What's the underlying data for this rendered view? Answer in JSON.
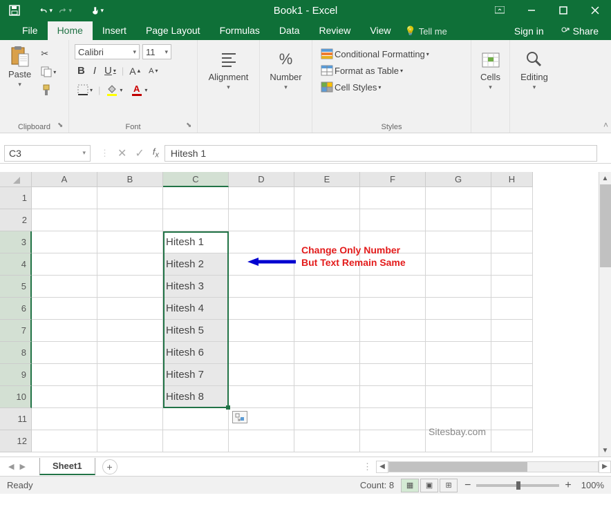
{
  "title": "Book1 - Excel",
  "tabs": {
    "file": "File",
    "home": "Home",
    "insert": "Insert",
    "pagelayout": "Page Layout",
    "formulas": "Formulas",
    "data": "Data",
    "review": "Review",
    "view": "View"
  },
  "tellme": "Tell me",
  "signin": "Sign in",
  "share": "Share",
  "ribbon": {
    "clipboard": {
      "paste": "Paste",
      "label": "Clipboard"
    },
    "font": {
      "name": "Calibri",
      "size": "11",
      "label": "Font"
    },
    "alignment": "Alignment",
    "number": "Number",
    "styles": {
      "cond": "Conditional Formatting",
      "table": "Format as Table",
      "cellstyles": "Cell Styles",
      "label": "Styles"
    },
    "cells": "Cells",
    "editing": "Editing"
  },
  "namebox": "C3",
  "formula": "Hitesh 1",
  "columns": [
    "A",
    "B",
    "C",
    "D",
    "E",
    "F",
    "G",
    "H"
  ],
  "rows": [
    "1",
    "2",
    "3",
    "4",
    "5",
    "6",
    "7",
    "8",
    "9",
    "10",
    "11",
    "12"
  ],
  "data": {
    "C3": "Hitesh 1",
    "C4": "Hitesh 2",
    "C5": "Hitesh 3",
    "C6": "Hitesh 4",
    "C7": "Hitesh 5",
    "C8": "Hitesh 6",
    "C9": "Hitesh 7",
    "C10": "Hitesh 8"
  },
  "annotation": {
    "line1": "Change Only Number",
    "line2": "But Text Remain Same"
  },
  "watermark": "Sitesbay.com",
  "sheet": "Sheet1",
  "status": {
    "ready": "Ready",
    "count": "Count: 8",
    "zoom": "100%"
  },
  "selected_col": "C",
  "selected_rows": [
    3,
    4,
    5,
    6,
    7,
    8,
    9,
    10
  ],
  "active_cell": "C3"
}
